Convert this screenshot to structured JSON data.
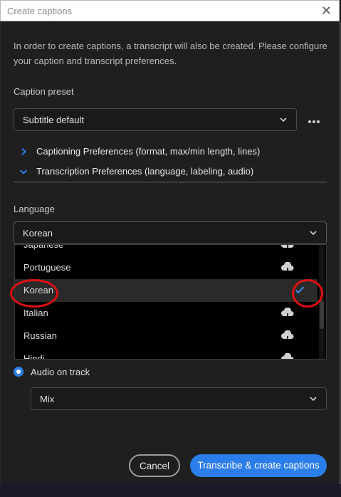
{
  "window": {
    "title": "Create captions"
  },
  "intro": "In order to create captions, a transcript will also be created. Please configure your caption and transcript preferences.",
  "caption_preset": {
    "label": "Caption preset",
    "value": "Subtitle default"
  },
  "preferences": {
    "captioning": "Captioning Preferences (format, max/min length, lines)",
    "transcription": "Transcription Preferences (language, labeling, audio)"
  },
  "language": {
    "label": "Language",
    "value": "Korean",
    "options": [
      {
        "label": "Japanese",
        "status": "download"
      },
      {
        "label": "Portuguese",
        "status": "download"
      },
      {
        "label": "Korean",
        "status": "selected"
      },
      {
        "label": "Italian",
        "status": "download"
      },
      {
        "label": "Russian",
        "status": "download"
      },
      {
        "label": "Hindi",
        "status": "download"
      }
    ]
  },
  "audio": {
    "label": "Audio on track",
    "value": "Mix"
  },
  "buttons": {
    "cancel": "Cancel",
    "primary": "Transcribe & create captions"
  },
  "colors": {
    "accent": "#2b7de9",
    "annotation": "#e01010"
  }
}
